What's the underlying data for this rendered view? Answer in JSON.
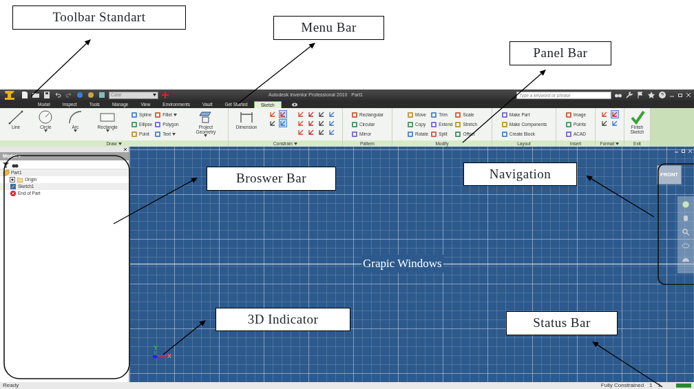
{
  "annotations": [
    {
      "text": "Toolbar Standart",
      "kind": "box"
    },
    {
      "text": "Menu Bar",
      "kind": "box"
    },
    {
      "text": "Panel Bar",
      "kind": "box"
    },
    {
      "text": "Broswer Bar",
      "kind": "box"
    },
    {
      "text": "Navigation",
      "kind": "box"
    },
    {
      "text": "Grapic Windows",
      "kind": "label"
    },
    {
      "text": "3D Indicator",
      "kind": "box"
    },
    {
      "text": "Status Bar",
      "kind": "box"
    }
  ],
  "title_bar": {
    "color_dropdown": "Color",
    "title": "Autodesk Inventor Professional 2010",
    "document": "Part1",
    "search": {
      "placeholder": "Type a keyword or phrase"
    }
  },
  "menu_tabs": [
    {
      "label": "Model",
      "selected": false
    },
    {
      "label": "Inspect",
      "selected": false
    },
    {
      "label": "Tools",
      "selected": false
    },
    {
      "label": "Manage",
      "selected": false
    },
    {
      "label": "View",
      "selected": false
    },
    {
      "label": "Environments",
      "selected": false
    },
    {
      "label": "Vault",
      "selected": false
    },
    {
      "label": "Get Started",
      "selected": false
    },
    {
      "label": "Sketch",
      "selected": true
    }
  ],
  "ribbon": {
    "panels": [
      {
        "title": "Draw",
        "menu": true,
        "tools": [
          {
            "kind": "large",
            "label": "Line",
            "menu": false
          },
          {
            "kind": "large",
            "label": "Circle",
            "menu": true
          },
          {
            "kind": "large",
            "label": "Arc",
            "menu": true
          },
          {
            "kind": "large",
            "label": "Rectangle",
            "menu": true
          },
          {
            "kind": "grid",
            "rows": [
              [
                {
                  "kind": "tool",
                  "label": "Spline",
                  "menu": false
                },
                {
                  "kind": "tool",
                  "label": "Fillet",
                  "menu": true
                }
              ],
              [
                {
                  "kind": "tool",
                  "label": "Ellipse",
                  "menu": false
                },
                {
                  "kind": "tool",
                  "label": "Polygon",
                  "menu": false
                }
              ],
              [
                {
                  "kind": "tool",
                  "label": "Point",
                  "menu": false
                },
                {
                  "kind": "tool",
                  "label": "Text",
                  "menu": true
                }
              ]
            ]
          },
          {
            "kind": "large",
            "label": "Project Geometry",
            "menu": true
          }
        ]
      },
      {
        "title": "Constrain",
        "menu": true,
        "tools": [
          {
            "kind": "large",
            "label": "Dimension",
            "menu": false
          },
          {
            "kind": "grid",
            "rows": [
              [
                {
                  "kind": "icon",
                  "selected": false
                },
                {
                  "kind": "icon",
                  "selected": true
                }
              ],
              [
                {
                  "kind": "icon",
                  "selected": false
                },
                {
                  "kind": "icon",
                  "selected": true
                }
              ]
            ]
          },
          {
            "kind": "grid",
            "rows": [
              [
                {
                  "kind": "icon",
                  "selected": false
                },
                {
                  "kind": "icon",
                  "selected": false
                },
                {
                  "kind": "icon",
                  "selected": false
                },
                {
                  "kind": "icon",
                  "selected": false
                }
              ],
              [
                {
                  "kind": "icon",
                  "selected": false
                },
                {
                  "kind": "icon",
                  "selected": false
                },
                {
                  "kind": "icon",
                  "selected": false
                },
                {
                  "kind": "icon",
                  "selected": false
                }
              ],
              [
                {
                  "kind": "icon",
                  "selected": false
                },
                {
                  "kind": "icon",
                  "selected": false
                },
                {
                  "kind": "icon",
                  "selected": false
                },
                {
                  "kind": "icon",
                  "selected": false
                }
              ]
            ]
          }
        ]
      },
      {
        "title": "Pattern",
        "menu": false,
        "tools": [
          {
            "kind": "grid",
            "rows": [
              [
                {
                  "kind": "tool",
                  "label": "Rectangular",
                  "menu": false
                }
              ],
              [
                {
                  "kind": "tool",
                  "label": "Circular",
                  "menu": false
                }
              ],
              [
                {
                  "kind": "tool",
                  "label": "Mirror",
                  "menu": false
                }
              ]
            ]
          }
        ]
      },
      {
        "title": "Modify",
        "menu": false,
        "tools": [
          {
            "kind": "grid",
            "rows": [
              [
                {
                  "kind": "tool",
                  "label": "Move",
                  "menu": false
                },
                {
                  "kind": "tool",
                  "label": "Trim",
                  "menu": false
                },
                {
                  "kind": "tool",
                  "label": "Scale",
                  "menu": false
                }
              ],
              [
                {
                  "kind": "tool",
                  "label": "Copy",
                  "menu": false
                },
                {
                  "kind": "tool",
                  "label": "Extend",
                  "menu": false
                },
                {
                  "kind": "tool",
                  "label": "Stretch",
                  "menu": false
                }
              ],
              [
                {
                  "kind": "tool",
                  "label": "Rotate",
                  "menu": false
                },
                {
                  "kind": "tool",
                  "label": "Split",
                  "menu": false
                },
                {
                  "kind": "tool",
                  "label": "Offset",
                  "menu": false
                }
              ]
            ]
          }
        ]
      },
      {
        "title": "Layout",
        "menu": false,
        "tools": [
          {
            "kind": "grid",
            "rows": [
              [
                {
                  "kind": "tool",
                  "label": "Make Part",
                  "menu": false
                }
              ],
              [
                {
                  "kind": "tool",
                  "label": "Make Components",
                  "menu": false
                }
              ],
              [
                {
                  "kind": "tool",
                  "label": "Create Block",
                  "menu": false
                }
              ]
            ]
          }
        ]
      },
      {
        "title": "Insert",
        "menu": false,
        "tools": [
          {
            "kind": "grid",
            "rows": [
              [
                {
                  "kind": "tool",
                  "label": "Image",
                  "menu": false
                }
              ],
              [
                {
                  "kind": "tool",
                  "label": "Points",
                  "menu": false
                }
              ],
              [
                {
                  "kind": "tool",
                  "label": "ACAD",
                  "menu": false
                }
              ]
            ]
          }
        ]
      },
      {
        "title": "Format",
        "menu": true,
        "tools": [
          {
            "kind": "grid",
            "rows": [
              [
                {
                  "kind": "icon",
                  "selected": false
                },
                {
                  "kind": "icon",
                  "selected": true
                }
              ],
              [
                {
                  "kind": "icon",
                  "selected": false
                },
                {
                  "kind": "icon",
                  "selected": false
                }
              ]
            ]
          }
        ]
      },
      {
        "title": "Exit",
        "menu": false,
        "tools": [
          {
            "kind": "large",
            "label": "Finish Sketch",
            "menu": false
          }
        ]
      }
    ]
  },
  "browser": {
    "title": "Model",
    "tree": [
      {
        "label": "Part1",
        "kind": "part",
        "children": [
          {
            "label": "Origin",
            "kind": "folder",
            "expanded": false
          },
          {
            "label": "Sketch1",
            "kind": "sketch"
          },
          {
            "label": "End of Part",
            "kind": "end"
          }
        ]
      }
    ]
  },
  "graphics": {
    "view_cube": "FRONT",
    "axes": [
      "Y",
      "X"
    ]
  },
  "status_bar": {
    "message": "Ready",
    "constraint": "Fully Constrained",
    "values": [
      "1",
      "1"
    ]
  }
}
